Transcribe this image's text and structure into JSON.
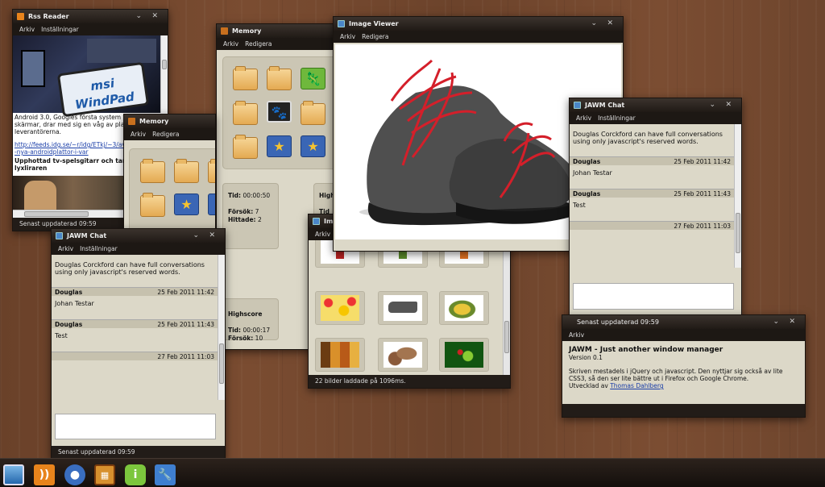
{
  "rss": {
    "title": "Rss Reader",
    "menu": [
      "Arkiv",
      "Inställningar"
    ],
    "text": "Android 3.0, Googles första system för stora skärmar, drar med sig en våg av plattor hos leverantörerna.",
    "link": "http://feeds.idg.se/~r/idg/ETkj/~3/av-nya-androidplattor-i-var",
    "headline": "Upphottad tv-spelsgitarr och tar för lyxliraren",
    "status": "Senast uppdaterad 09:59",
    "brand": "msi WindPad"
  },
  "memory1": {
    "title": "Memory",
    "menu": [
      "Arkiv",
      "Redigera"
    ],
    "stats": {
      "time_label": "Tid:",
      "time": "00:00:50",
      "tries_label": "Försök:",
      "tries": "7",
      "found_label": "Hittade:",
      "found": "2"
    },
    "highscore": {
      "title": "Highscore",
      "time_label": "Tid:",
      "time": "00:00:17",
      "tries_label": "Försök:",
      "tries": "10"
    },
    "stat_right_label": "High",
    "stat_right_tid": "Tid"
  },
  "memory2": {
    "title": "Memory",
    "menu": [
      "Arkiv",
      "Redigera"
    ]
  },
  "viewer": {
    "title": "Image Viewer",
    "menu": [
      "Arkiv",
      "Redigera"
    ]
  },
  "gallery": {
    "title": "Im",
    "menu": [
      "Arkiv"
    ],
    "status": "22 bilder laddade på 1096ms."
  },
  "chat1": {
    "title": "JAWM Chat",
    "menu": [
      "Arkiv",
      "Inställningar"
    ],
    "intro": "Douglas Corckford can have full conversations using only javascript's reserved words.",
    "messages": [
      {
        "from": "Douglas",
        "date": "25 Feb 2011 11:42",
        "text": "Johan Testar"
      },
      {
        "from": "Douglas",
        "date": "25 Feb 2011 11:43",
        "text": "Test"
      },
      {
        "from": "",
        "date": "27 Feb 2011 11:03",
        "text": ""
      }
    ],
    "status": "Senast uppdaterad 09:59"
  },
  "chat2": {
    "title": "JAWM Chat",
    "menu": [
      "Arkiv",
      "Inställningar"
    ],
    "intro": "Douglas Corckford can have full conversations using only javascript's reserved words.",
    "messages": [
      {
        "from": "Douglas",
        "date": "25 Feb 2011 11:42",
        "text": "Johan Testar"
      },
      {
        "from": "Douglas",
        "date": "25 Feb 2011 11:43",
        "text": "Test"
      },
      {
        "from": "",
        "date": "27 Feb 2011 11:03",
        "text": ""
      }
    ]
  },
  "about": {
    "title": "Senast uppdaterad 09:59",
    "menu": [
      "Arkiv"
    ],
    "heading": "JAWM - Just another window manager",
    "version": "Version 0.1",
    "desc": "Skriven mestadels i jQuery och javascript. Den nyttjar sig också av lite CSS3, så den ser lite bättre ut i Firefox och Google Chrome.",
    "dev_prefix": "Utvecklad av",
    "dev_name": "Thomas Dahlberg"
  },
  "controls": {
    "minimize": "⌄",
    "close": "✕"
  },
  "taskbar": [
    "image-viewer-icon",
    "rss-icon",
    "memory-icon",
    "gallery-icon",
    "info-icon",
    "tools-icon"
  ]
}
